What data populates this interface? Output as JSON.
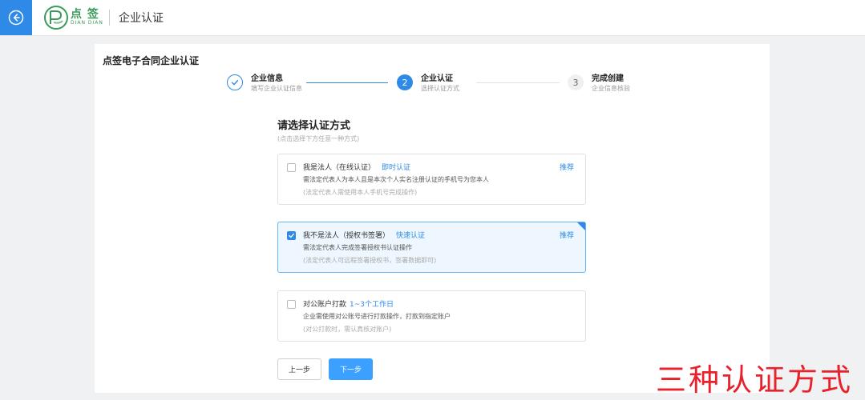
{
  "header": {
    "logo_cn": "点 签",
    "logo_en": "DIAN DIAN",
    "title": "企业认证"
  },
  "page": {
    "title": "点签电子合同企业认证"
  },
  "steps": [
    {
      "number": "",
      "title": "企业信息",
      "subtitle": "填写企业认证信息",
      "state": "done"
    },
    {
      "number": "2",
      "title": "企业认证",
      "subtitle": "选择认证方式",
      "state": "active"
    },
    {
      "number": "3",
      "title": "完成创建",
      "subtitle": "企业信息核验",
      "state": "todo"
    }
  ],
  "section": {
    "title": "请选择认证方式",
    "subtitle": "(点击选择下方任意一种方式)"
  },
  "options": [
    {
      "label": "我是法人（在线认证）",
      "tag": "即时认证",
      "recommend": "推荐",
      "desc": "需法定代表人为本人且是本次个人实名注册认证的手机号为您本人",
      "note": "(法定代表人需使用本人手机号完成操作)",
      "checked": false
    },
    {
      "label": "我不是法人（授权书签署）",
      "tag": "快速认证",
      "recommend": "推荐",
      "desc": "需法定代表人完成签署授权书认证操作",
      "note": "(法定代表人可远程签署授权书，签署数据即可)",
      "checked": true
    },
    {
      "label": "对公账户打款",
      "tag": "1~3个工作日",
      "recommend": "",
      "desc": "企业需使用对公账号进行打款操作，打款到指定账户",
      "note": "(对公打款时，需认真核对账户)",
      "checked": false
    }
  ],
  "buttons": {
    "prev": "上一步",
    "next": "下一步"
  },
  "overlay_caption": "三种认证方式",
  "colors": {
    "accent": "#2e8ae6",
    "brand_green": "#3a9a5a",
    "caption_red": "#e8212b"
  }
}
